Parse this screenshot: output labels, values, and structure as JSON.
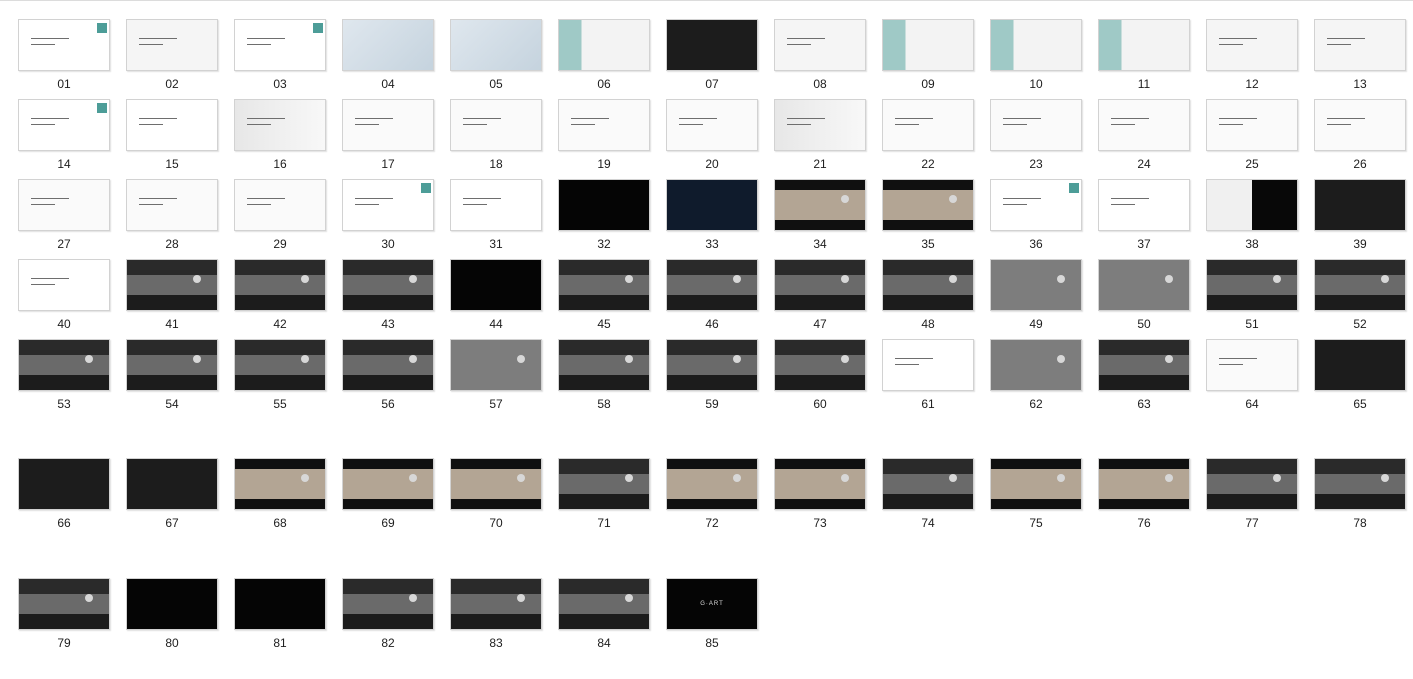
{
  "window": {},
  "thumbnails": [
    {
      "id": "01",
      "theme": "t-white"
    },
    {
      "id": "02",
      "theme": "t-light"
    },
    {
      "id": "03",
      "theme": "t-white"
    },
    {
      "id": "04",
      "theme": "t-map"
    },
    {
      "id": "05",
      "theme": "t-map"
    },
    {
      "id": "06",
      "theme": "t-teal"
    },
    {
      "id": "07",
      "theme": "t-dark"
    },
    {
      "id": "08",
      "theme": "t-light"
    },
    {
      "id": "09",
      "theme": "t-teal"
    },
    {
      "id": "10",
      "theme": "t-teal"
    },
    {
      "id": "11",
      "theme": "t-teal"
    },
    {
      "id": "12",
      "theme": "t-light"
    },
    {
      "id": "13",
      "theme": "t-light"
    },
    {
      "id": "14",
      "theme": "t-white"
    },
    {
      "id": "15",
      "theme": "t-white"
    },
    {
      "id": "16",
      "theme": "t-red"
    },
    {
      "id": "17",
      "theme": "t-grid"
    },
    {
      "id": "18",
      "theme": "t-grid"
    },
    {
      "id": "19",
      "theme": "t-grid"
    },
    {
      "id": "20",
      "theme": "t-grid"
    },
    {
      "id": "21",
      "theme": "t-red"
    },
    {
      "id": "22",
      "theme": "t-grid"
    },
    {
      "id": "23",
      "theme": "t-grid"
    },
    {
      "id": "24",
      "theme": "t-grid"
    },
    {
      "id": "25",
      "theme": "t-grid"
    },
    {
      "id": "26",
      "theme": "t-grid"
    },
    {
      "id": "27",
      "theme": "t-grid"
    },
    {
      "id": "28",
      "theme": "t-grid"
    },
    {
      "id": "29",
      "theme": "t-grid"
    },
    {
      "id": "30",
      "theme": "t-white"
    },
    {
      "id": "31",
      "theme": "t-white"
    },
    {
      "id": "32",
      "theme": "t-black"
    },
    {
      "id": "33",
      "theme": "t-navy"
    },
    {
      "id": "34",
      "theme": "t-warm"
    },
    {
      "id": "35",
      "theme": "t-warm"
    },
    {
      "id": "36",
      "theme": "t-white"
    },
    {
      "id": "37",
      "theme": "t-white"
    },
    {
      "id": "38",
      "theme": "t-split"
    },
    {
      "id": "39",
      "theme": "t-dark"
    },
    {
      "id": "40",
      "theme": "t-white"
    },
    {
      "id": "41",
      "theme": "t-room"
    },
    {
      "id": "42",
      "theme": "t-room"
    },
    {
      "id": "43",
      "theme": "t-room"
    },
    {
      "id": "44",
      "theme": "t-black"
    },
    {
      "id": "45",
      "theme": "t-room"
    },
    {
      "id": "46",
      "theme": "t-room"
    },
    {
      "id": "47",
      "theme": "t-room"
    },
    {
      "id": "48",
      "theme": "t-room"
    },
    {
      "id": "49",
      "theme": "t-gray"
    },
    {
      "id": "50",
      "theme": "t-gray"
    },
    {
      "id": "51",
      "theme": "t-room"
    },
    {
      "id": "52",
      "theme": "t-room"
    },
    {
      "id": "53",
      "theme": "t-room"
    },
    {
      "id": "54",
      "theme": "t-room"
    },
    {
      "id": "55",
      "theme": "t-room"
    },
    {
      "id": "56",
      "theme": "t-room"
    },
    {
      "id": "57",
      "theme": "t-gray"
    },
    {
      "id": "58",
      "theme": "t-room"
    },
    {
      "id": "59",
      "theme": "t-room"
    },
    {
      "id": "60",
      "theme": "t-room"
    },
    {
      "id": "61",
      "theme": "t-white"
    },
    {
      "id": "62",
      "theme": "t-gray"
    },
    {
      "id": "63",
      "theme": "t-room"
    },
    {
      "id": "64",
      "theme": "t-grid"
    },
    {
      "id": "65",
      "theme": "t-dark"
    },
    {
      "id": "66",
      "theme": "t-dark"
    },
    {
      "id": "67",
      "theme": "t-dark"
    },
    {
      "id": "68",
      "theme": "t-warm"
    },
    {
      "id": "69",
      "theme": "t-warm"
    },
    {
      "id": "70",
      "theme": "t-warm"
    },
    {
      "id": "71",
      "theme": "t-room"
    },
    {
      "id": "72",
      "theme": "t-warm"
    },
    {
      "id": "73",
      "theme": "t-warm"
    },
    {
      "id": "74",
      "theme": "t-room"
    },
    {
      "id": "75",
      "theme": "t-warm"
    },
    {
      "id": "76",
      "theme": "t-warm"
    },
    {
      "id": "77",
      "theme": "t-room"
    },
    {
      "id": "78",
      "theme": "t-room"
    },
    {
      "id": "79",
      "theme": "t-room"
    },
    {
      "id": "80",
      "theme": "t-black"
    },
    {
      "id": "81",
      "theme": "t-black"
    },
    {
      "id": "82",
      "theme": "t-room"
    },
    {
      "id": "83",
      "theme": "t-room"
    },
    {
      "id": "84",
      "theme": "t-room"
    },
    {
      "id": "85",
      "theme": "t-black",
      "text": "G·ART"
    }
  ]
}
